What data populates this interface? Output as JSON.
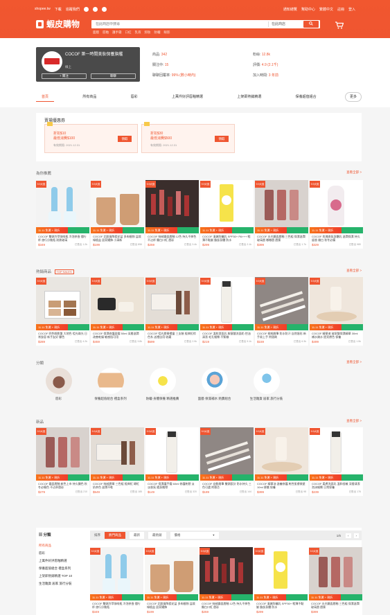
{
  "topnav": {
    "left": [
      "shopee.tw",
      "下載",
      "追蹤我們"
    ],
    "right": [
      "通知總覽",
      "幫助中心",
      "繁體中文",
      "註冊",
      "登入"
    ]
  },
  "header": {
    "brand": "蝦皮購物",
    "search_placeholder": "在此商店中搜尋",
    "search_scope": "在此商店",
    "search_button": "搜尋",
    "hotwords": [
      "面膜",
      "唇釉",
      "護手霜",
      "口紅",
      "乳液",
      "卸妝",
      "防曬",
      "眼影"
    ],
    "cart_icon": "cart-icon"
  },
  "shop": {
    "name": "COCOF 第一時間美妝保養旗艦",
    "status": "線上",
    "follow_btn": "+ 關注",
    "chat_btn": "聊聊",
    "info": [
      {
        "label": "商品:",
        "value": "342"
      },
      {
        "label": "粉絲:",
        "value": "12.8k"
      },
      {
        "label": "關注中:",
        "value": "15"
      },
      {
        "label": "評價:",
        "value": "4.9 (2.1千)"
      },
      {
        "label": "聊聊回覆率:",
        "value": "99% (數小時內)"
      },
      {
        "label": "加入時間:",
        "value": "3 年前"
      }
    ]
  },
  "tabs": [
    "首頁",
    "所有商品",
    "唇彩",
    "上萬件好評唇釉精選",
    "上架即熱銷精選",
    "保養超值組合",
    "更多"
  ],
  "vouchers": {
    "title": "賣場優惠券",
    "items": [
      {
        "line1": "折扣$10",
        "line2": "最低消費$100",
        "note": "有效期限: 2021.12.31",
        "button": "領取"
      },
      {
        "line1": "折扣$30",
        "line2": "最低消費$500",
        "note": "有效期限: 2021.12.31",
        "button": "領取"
      }
    ]
  },
  "sections": {
    "recommend": {
      "title": "為你推薦",
      "more": "查看全部 >"
    },
    "hot": {
      "title": "熱銷商品",
      "badge": "TOP SALES",
      "more": "查看全部 >"
    },
    "categories": {
      "title": "分類",
      "more": "查看全部 >"
    },
    "new": {
      "title": "新品",
      "more": "查看全部 >"
    }
  },
  "products_recommend": [
    {
      "name": "COCOF 雙頭冷萃咖啡瓶 冷泡茶壺 隨行杯 旅行分裝瓶 耐熱玻璃",
      "price": "$349",
      "sold": "已售出 1.2k",
      "badge": "9.9大促",
      "ribbon": "11.11 免運 + 現折"
    },
    {
      "name": "COCOF 北歐風陶瓷花盆 多肉植物 盆栽 綠植盆 居家擺飾 小清新",
      "price": "$199",
      "sold": "已售出 856",
      "badge": "9.9大促",
      "ribbon": "11.11 免運 + 現折"
    },
    {
      "name": "COCOF 絲絨霧面唇釉 12色 持久不掉色 不沾杯 顯白口紅 唇彩",
      "price": "$259",
      "sold": "已售出 3.4k",
      "badge": "9.9大促",
      "ribbon": "11.11 免運 + 現折"
    },
    {
      "name": "COCOF 清爽防曬乳 SPF50+ PA+++ 輕薄不黏膩 臉部身體 防水",
      "price": "$299",
      "sold": "已售出 2.1k",
      "badge": "9.9大促",
      "ribbon": "11.11 免運 + 現折"
    },
    {
      "name": "COCOF 水光鏡面唇釉 三色組 保濕滋潤 玻璃唇 嘟嘟唇 唇蜜",
      "price": "$399",
      "sold": "已售出 1.7k",
      "badge": "9.9大促",
      "ribbon": "11.11 免運 + 現折"
    },
    {
      "name": "COCOF 玫瑰香氛身體乳 滋潤保濕 持久留香 嫩白 秋冬必備",
      "price": "$329",
      "sold": "已售出 980",
      "badge": "9.9大促",
      "ribbon": "11.11 免運 + 現折"
    }
  ],
  "products_hot": [
    {
      "name": "COCOF 四色眼影盤 大地色 啞光珠光 日常妝容 新手友好 顯色",
      "price": "$289",
      "sold": "已售出 4.2k",
      "badge": "9.9大促",
      "ribbon": "11.11 免運 + 現折"
    },
    {
      "name": "COCOF 保濕修護面霜 50ml 深層滋潤 改善乾燥 敏感肌可用",
      "price": "$459",
      "sold": "已售出 3.8k",
      "badge": "9.9大促",
      "ribbon": "11.11 免運 + 現折"
    },
    {
      "name": "COCOF 啞光唇膏禮盒 三支裝 經典紅棕色系 送禮自用 收藏",
      "price": "$599",
      "sold": "已售出 2.9k",
      "badge": "9.9大促",
      "ribbon": "11.11 免運 + 現折"
    },
    {
      "name": "COCOF 溫和潔面乳 胺基酸洗面奶 控油清潔 毛孔細緻 不緊繃",
      "price": "$219",
      "sold": "已售出 5.1k",
      "badge": "9.9大促",
      "ribbon": "11.11 免運 + 現折"
    },
    {
      "name": "COCOF 極細眉筆 防水防汗 自然眉形 新手易上手 附眉刷",
      "price": "$159",
      "sold": "已售出 6.3k",
      "badge": "9.9大促",
      "ribbon": "11.11 免運 + 現折"
    },
    {
      "name": "COCOF 精華液 玻尿酸保濕精華 30ml 補水鎖水 提亮膚色 保養",
      "price": "$499",
      "sold": "已售出 1.5k",
      "badge": "9.9大促",
      "ribbon": "11.11 免運 + 現折"
    }
  ],
  "categories": [
    {
      "label": "唇彩"
    },
    {
      "label": "保養超值組合 禮盒系列"
    },
    {
      "label": "防曬·身體保養 精選推薦"
    },
    {
      "label": "面膜·保濕補水 熱賣組合"
    },
    {
      "label": "生活雜貨 居家 旅行分裝"
    }
  ],
  "products_new": [
    {
      "name": "COCOF 霧面唇釉 新色上市 持久顯色 秋冬必備色 不沾杯唇彩",
      "price": "$279",
      "sold": "已售出 210",
      "badge": "9.9大促",
      "ribbon": "11.11 免運 + 現折"
    },
    {
      "name": "COCOF 絲絨唇膏 三色組 經典紅 磚紅 奶茶色 滋潤不乾",
      "price": "$549",
      "sold": "已售出 185",
      "badge": "9.9大促",
      "ribbon": "11.11 免運 + 現折"
    },
    {
      "name": "COCOF 保濕護手霜 60ml 修護乾裂 淡淡香氛 隨身攜帶",
      "price": "$149",
      "sold": "已售出 320",
      "badge": "9.9大促",
      "ribbon": "11.11 免運 + 現折"
    },
    {
      "name": "COCOF 自動眉筆 雙頭設計 防水持久 三色可選 附替芯",
      "price": "$189",
      "sold": "已售出 144",
      "badge": "9.9大促",
      "ribbon": "11.11 免運 + 現折"
    },
    {
      "name": "COCOF 精華油 滋養修護 乾性肌膚救星 10ml 便攜 保養",
      "price": "$399",
      "sold": "已售出 98",
      "badge": "9.9大促",
      "ribbon": "11.11 免運 + 現折"
    },
    {
      "name": "COCOF 柔膚洗面乳 溫和低敏 深層清潔 泡沫細緻 日常保養",
      "price": "$239",
      "sold": "已售出 176",
      "badge": "9.9大促",
      "ribbon": "11.11 免運 + 現折"
    }
  ],
  "bottom": {
    "side_title": "分類",
    "side_items": [
      "所有商品",
      "唇彩",
      "上萬件好評唇釉精選",
      "保養超值組合 禮盒系列",
      "上架即熱銷精選 TOP 10",
      "生活雜貨 居家 旅行分裝"
    ],
    "sort_label": "排序",
    "sort_options": [
      "熱門商品",
      "最新",
      "最熱銷"
    ],
    "price_select": "價格",
    "page": "1/6"
  },
  "products_bottom": [
    {
      "name": "COCOF 雙頭冷萃咖啡瓶 冷泡茶壺 隨行杯 旅行分裝瓶",
      "price": "$349",
      "badge": "9.9大促",
      "ribbon": "11.11 免運 + 現折"
    },
    {
      "name": "COCOF 北歐風陶瓷花盆 多肉植物 盆栽 綠植盆 居家擺飾",
      "price": "$199",
      "badge": "9.9大促",
      "ribbon": "11.11 免運 + 現折"
    },
    {
      "name": "COCOF 絲絨霧面唇釉 12色 持久不掉色 顯白口紅 唇彩",
      "price": "$259",
      "badge": "9.9大促",
      "ribbon": "11.11 免運 + 現折"
    },
    {
      "name": "COCOF 清爽防曬乳 SPF50+ 輕薄不黏膩 臉部身體 防水",
      "price": "$299",
      "badge": "9.9大促",
      "ribbon": "11.11 免運 + 現折"
    },
    {
      "name": "COCOF 水光鏡面唇釉 三色組 保濕滋潤 玻璃唇 唇蜜",
      "price": "$399",
      "badge": "9.9大促",
      "ribbon": "11.11 免運 + 現折"
    }
  ],
  "colors": {
    "accent": "#ef5530",
    "ribbon_green": "#26b36b"
  }
}
